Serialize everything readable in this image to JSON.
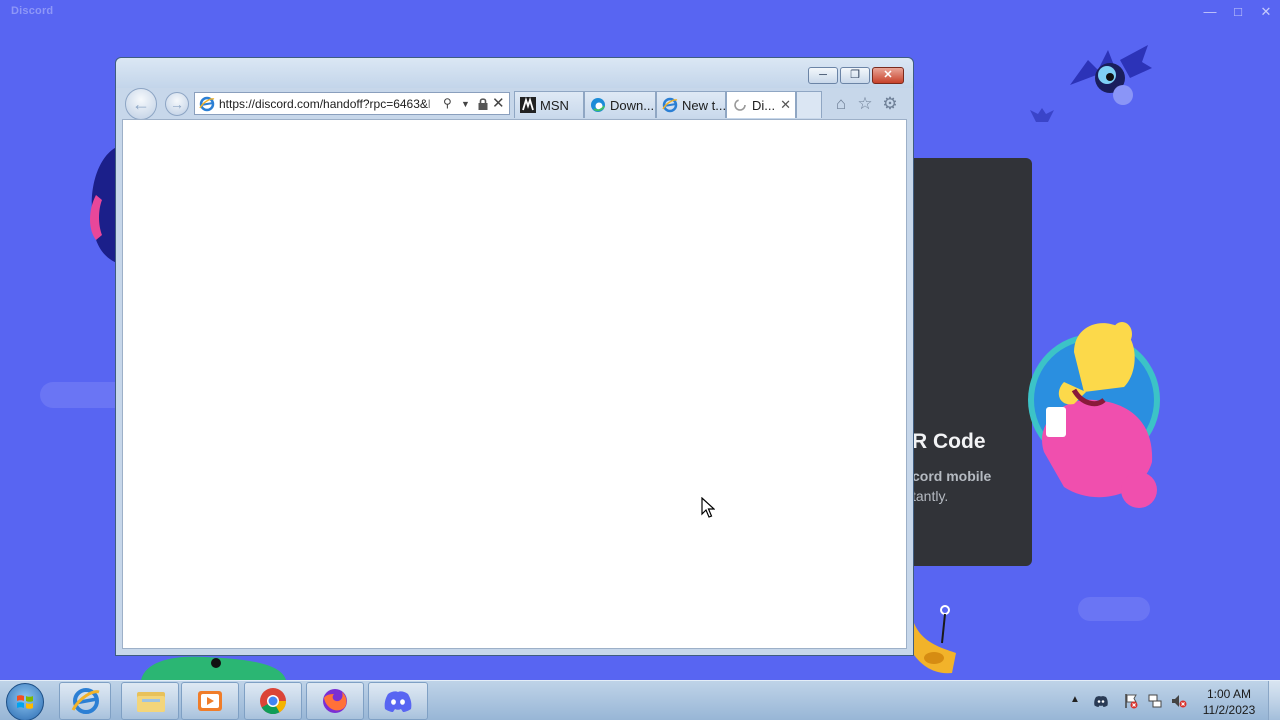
{
  "discord": {
    "app_title": "Discord",
    "qr_title": "R Code",
    "qr_desc_line1": "cord mobile",
    "qr_desc_line2": "tantly."
  },
  "ie": {
    "address": "https://discord.com/handoff?rpc=6463&",
    "address_suffix": "l",
    "tabs": [
      {
        "label": "MSN",
        "icon": "msn-icon"
      },
      {
        "label": "Down...",
        "icon": "edge-icon"
      },
      {
        "label": "New t...",
        "icon": "ie-icon"
      },
      {
        "label": "Di...",
        "icon": "loading-spinner-icon",
        "active": true
      }
    ]
  },
  "taskbar": {
    "pinned": [
      "internet-explorer",
      "file-explorer",
      "media-player",
      "chrome",
      "firefox",
      "discord"
    ],
    "time": "1:00 AM",
    "date": "11/2/2023"
  },
  "colors": {
    "discord_blurple": "#5865f2",
    "qr_card": "#313338",
    "taskbar": "#a9c4e0"
  }
}
